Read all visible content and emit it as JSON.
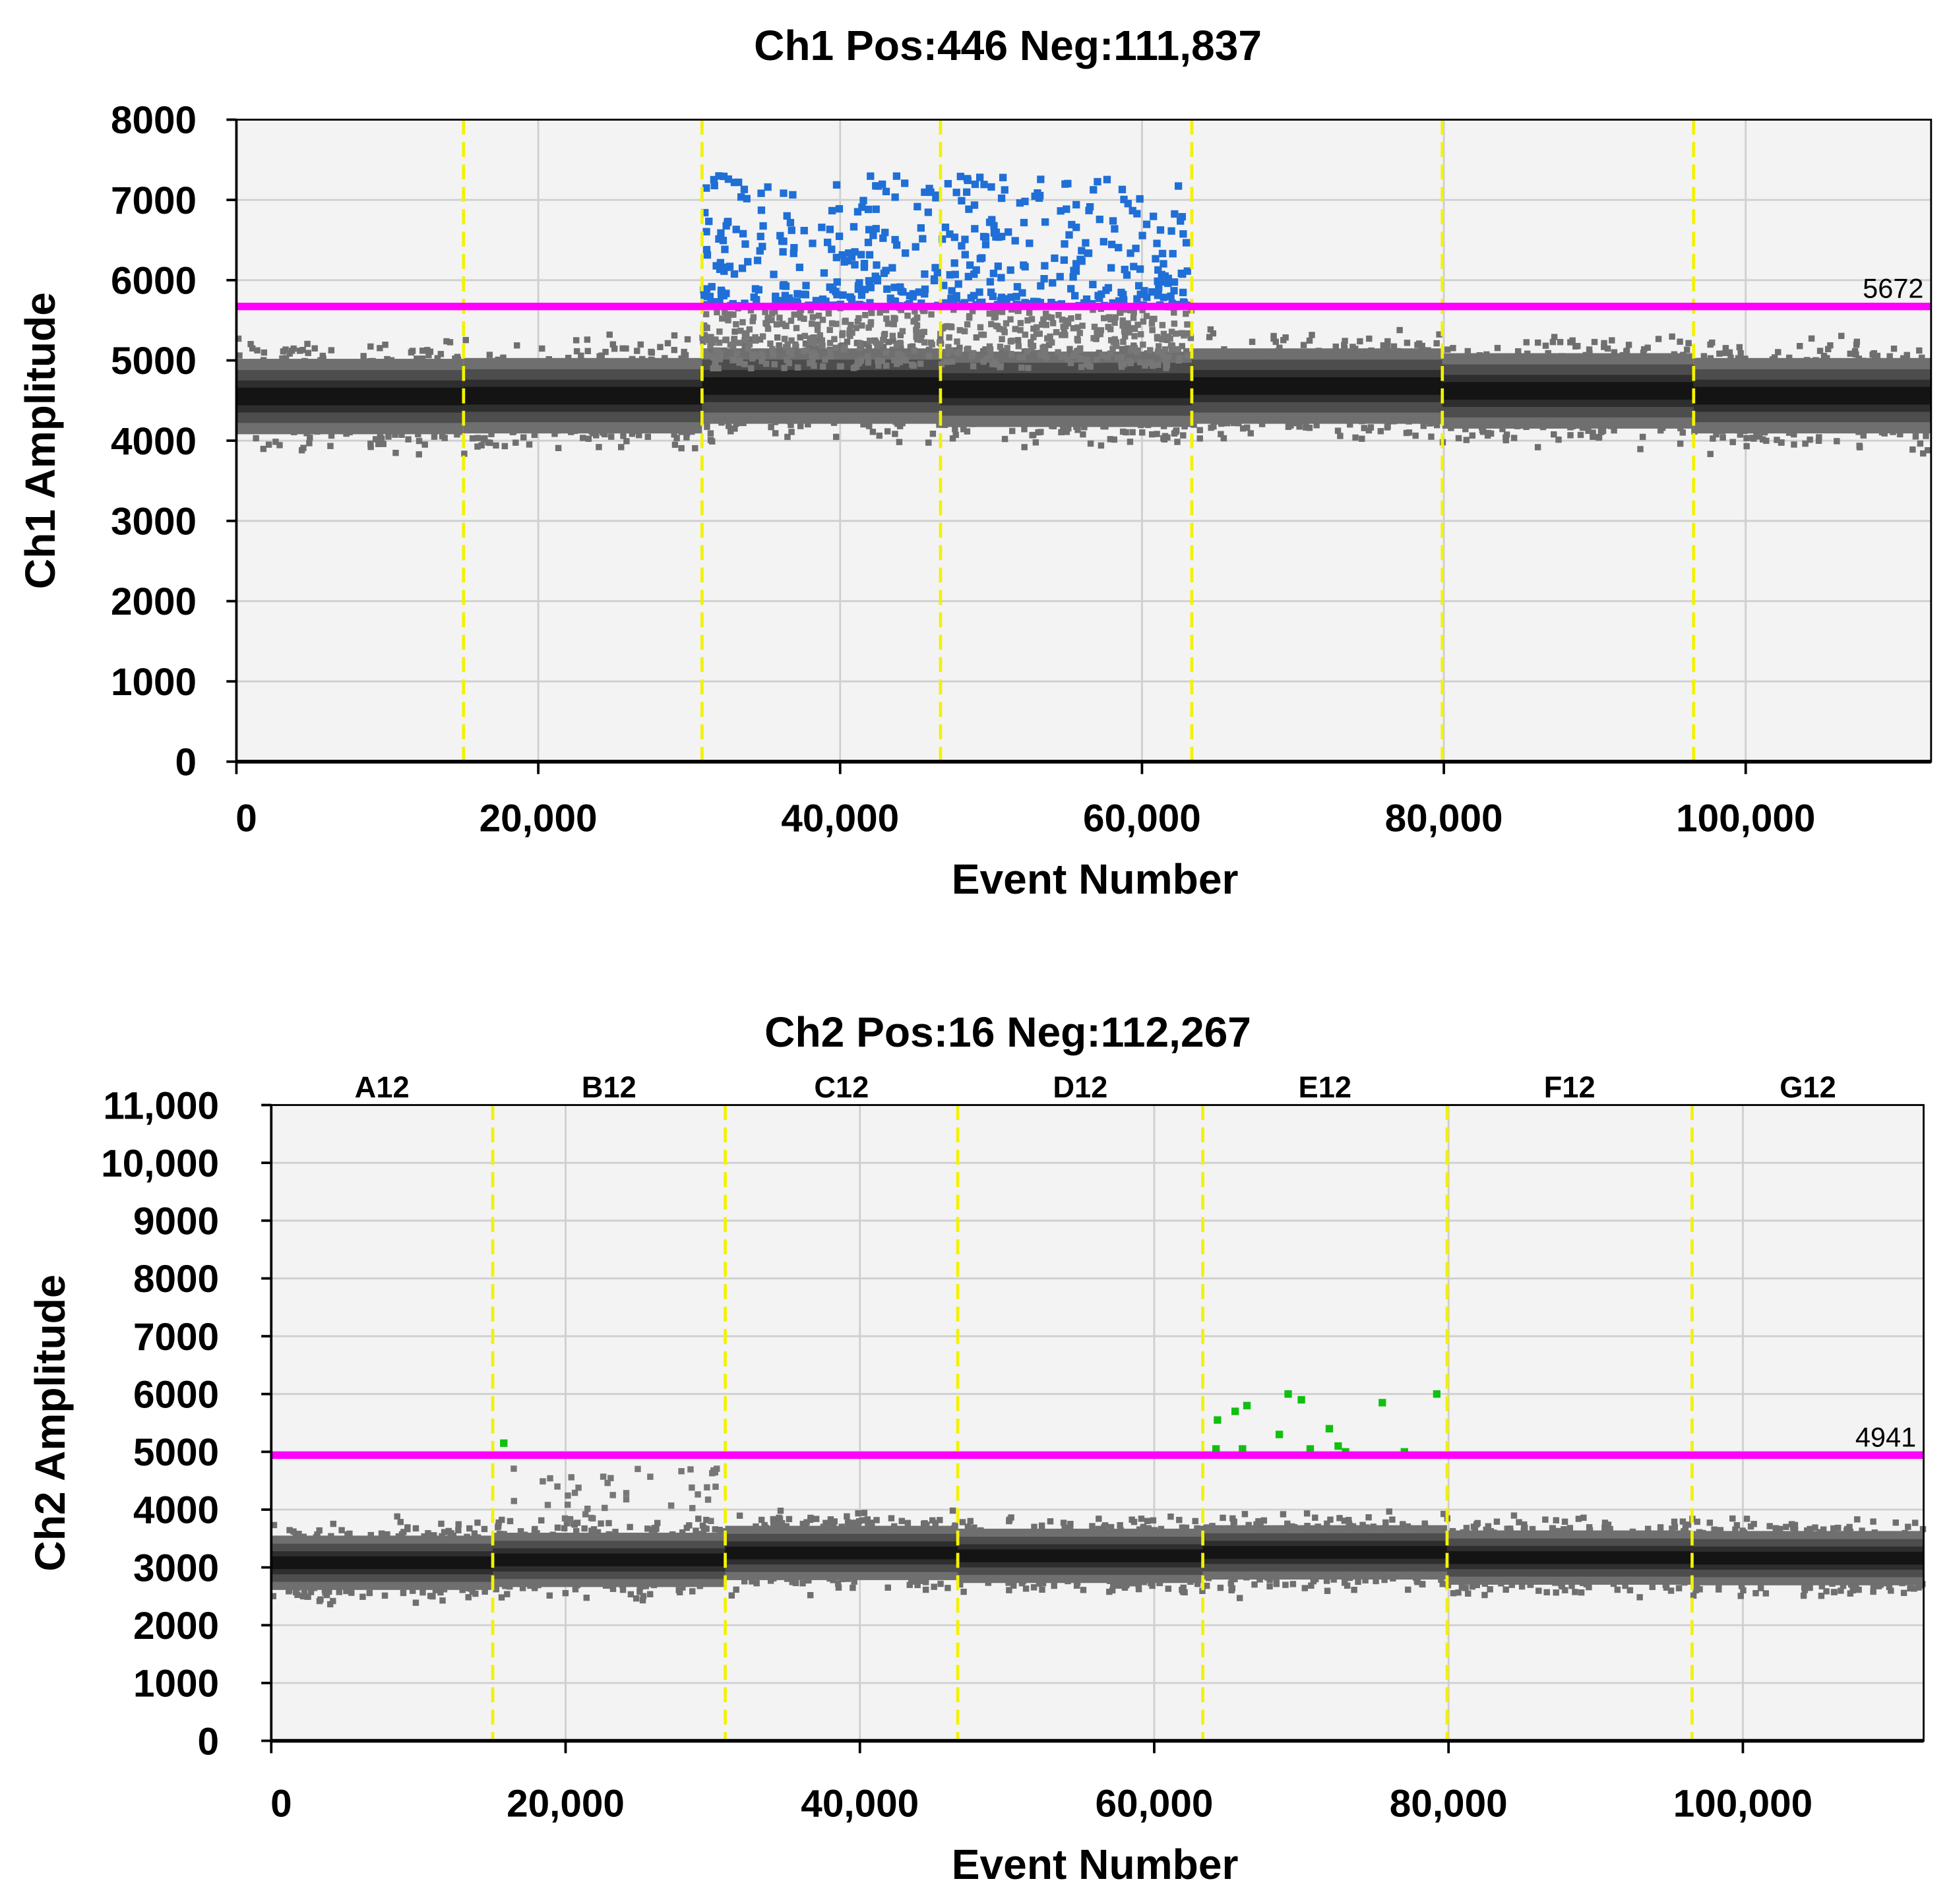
{
  "chart_data": [
    {
      "type": "scatter",
      "title": "Ch1 Pos:446 Neg:111,837",
      "xlabel": "Event Number",
      "ylabel": "Ch1 Amplitude",
      "xlim": [
        0,
        112283
      ],
      "ylim": [
        0,
        8000
      ],
      "xticks": [
        0,
        20000,
        40000,
        60000,
        80000,
        100000
      ],
      "xtick_labels": [
        "0",
        "20,000",
        "40,000",
        "60,000",
        "80,000",
        "100,000"
      ],
      "yticks": [
        0,
        1000,
        2000,
        3000,
        4000,
        5000,
        6000,
        7000,
        8000
      ],
      "ytick_labels": [
        "0",
        "1000",
        "2000",
        "3000",
        "4000",
        "5000",
        "6000",
        "7000",
        "8000"
      ],
      "grid": true,
      "threshold": 5672,
      "threshold_label": "5672",
      "positive_count": 446,
      "negative_count": 111837,
      "well_boundaries": [
        15050,
        30850,
        46650,
        63300,
        79900,
        96550
      ],
      "well_labels": [],
      "negative_cluster_centers": [
        4550,
        4560,
        4680,
        4640,
        4680,
        4620,
        4560
      ],
      "positive_range": {
        "x": [
          30850,
          63300
        ],
        "y": [
          5680,
          7300
        ]
      },
      "colors": {
        "positive": "#1f6fd6",
        "negative": "#111111",
        "threshold": "#ff00ff",
        "boundary": "#f2f200",
        "plot_bg": "#f3f3f3",
        "grid": "#cfcfcf"
      }
    },
    {
      "type": "scatter",
      "title": "Ch2 Pos:16 Neg:112,267",
      "xlabel": "Event Number",
      "ylabel": "Ch2 Amplitude",
      "xlim": [
        0,
        112283
      ],
      "ylim": [
        0,
        11000
      ],
      "xticks": [
        0,
        20000,
        40000,
        60000,
        80000,
        100000
      ],
      "xtick_labels": [
        "0",
        "20,000",
        "40,000",
        "60,000",
        "80,000",
        "100,000"
      ],
      "yticks": [
        0,
        1000,
        2000,
        3000,
        4000,
        5000,
        6000,
        7000,
        8000,
        9000,
        10000,
        11000
      ],
      "ytick_labels": [
        "0",
        "1000",
        "2000",
        "3000",
        "4000",
        "5000",
        "6000",
        "7000",
        "8000",
        "9000",
        "10,000",
        "11,000"
      ],
      "grid": true,
      "threshold": 4941,
      "threshold_label": "4941",
      "positive_count": 16,
      "negative_count": 112267,
      "well_boundaries": [
        15050,
        30850,
        46650,
        63300,
        79900,
        96550
      ],
      "well_labels": [
        "A12",
        "B12",
        "C12",
        "D12",
        "E12",
        "F12",
        "G12"
      ],
      "negative_cluster_centers": [
        3080,
        3130,
        3250,
        3200,
        3260,
        3170,
        3160
      ],
      "positive_points": [
        [
          15800,
          5150
        ],
        [
          64200,
          5050
        ],
        [
          64300,
          5550
        ],
        [
          65500,
          5700
        ],
        [
          66300,
          5800
        ],
        [
          66000,
          5050
        ],
        [
          68500,
          5300
        ],
        [
          69100,
          6000
        ],
        [
          70000,
          5900
        ],
        [
          70600,
          5050
        ],
        [
          71900,
          5400
        ],
        [
          72500,
          5100
        ],
        [
          73000,
          5000
        ],
        [
          75500,
          5850
        ],
        [
          77000,
          5000
        ],
        [
          79200,
          6000
        ]
      ],
      "colors": {
        "positive": "#10c010",
        "negative": "#111111",
        "threshold": "#ff00ff",
        "boundary": "#f2f200",
        "plot_bg": "#f3f3f3",
        "grid": "#cfcfcf"
      }
    }
  ]
}
